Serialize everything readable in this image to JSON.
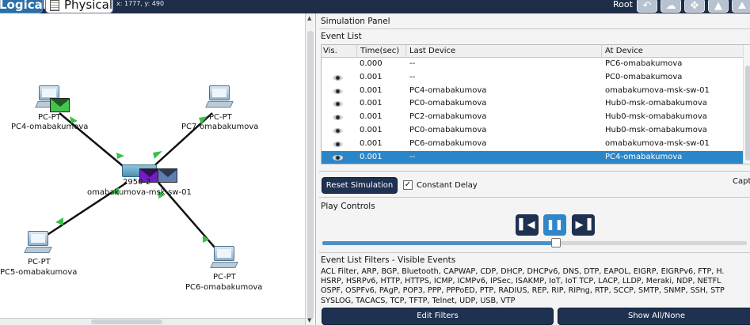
{
  "toolbar": {
    "tab_logical": "Logical",
    "tab_physical": "Physical",
    "coords": "x: 1777, y: 490",
    "root_label": "Root",
    "accent": "#2c6ea5",
    "bar_color": "#1e2d48"
  },
  "canvas": {
    "devices": [
      {
        "type": "PC-PT",
        "name": "PC4-omabakumova"
      },
      {
        "type": "PC-PT",
        "name": "PC7-omabakumova"
      },
      {
        "type": "2950-24",
        "name": "omabakumova-msk-sw-01",
        "type_visible": "2950-2"
      },
      {
        "type": "PC-PT",
        "name": "PC5-omabakumova"
      },
      {
        "type": "PC-PT",
        "name": "PC6-omabakumova"
      }
    ],
    "link_color": "#111111",
    "link_light_color": "#3bbf4a"
  },
  "panel": {
    "title": "Simulation Panel",
    "event_list": {
      "title": "Event List",
      "headers": {
        "vis": "Vis.",
        "time": "Time(sec)",
        "last": "Last Device",
        "at": "At Device"
      },
      "rows": [
        {
          "time": "0.000",
          "last": "--",
          "at": "PC6-omabakumova",
          "eye": false
        },
        {
          "time": "0.001",
          "last": "--",
          "at": "PC0-omabakumova",
          "eye": true
        },
        {
          "time": "0.001",
          "last": "PC4-omabakumova",
          "at": "omabakumova-msk-sw-01",
          "eye": true
        },
        {
          "time": "0.001",
          "last": "PC0-omabakumova",
          "at": "Hub0-msk-omabakumova",
          "eye": true
        },
        {
          "time": "0.001",
          "last": "PC2-omabakumova",
          "at": "Hub0-msk-omabakumova",
          "eye": true
        },
        {
          "time": "0.001",
          "last": "PC0-omabakumova",
          "at": "Hub0-msk-omabakumova",
          "eye": true
        },
        {
          "time": "0.001",
          "last": "PC6-omabakumova",
          "at": "omabakumova-msk-sw-01",
          "eye": true
        },
        {
          "time": "0.001",
          "last": "--",
          "at": "PC4-omabakumova",
          "eye": true,
          "selected": true
        }
      ]
    },
    "reset_button": "Reset Simulation",
    "constant_delay_label": "Constant Delay",
    "constant_delay_checked": true,
    "capture_label": "Capt",
    "play_controls": {
      "title": "Play Controls",
      "back_icon": "skip-back-icon",
      "pause_icon": "pause-icon",
      "forward_icon": "skip-forward-icon",
      "speed_fraction": 0.55
    },
    "filters": {
      "title": "Event List Filters - Visible Events",
      "lines": [
        "ACL Filter, ARP, BGP, Bluetooth, CAPWAP, CDP, DHCP, DHCPv6, DNS, DTP, EAPOL, EIGRP, EIGRPv6, FTP, H.",
        "HSRP, HSRPv6, HTTP, HTTPS, ICMP, ICMPv6, IPSec, ISAKMP, IoT, IoT TCP, LACP, LLDP, Meraki, NDP, NETFL",
        "OSPF, OSPFv6, PAgP, POP3, PPP, PPPoED, PTP, RADIUS, REP, RIP, RIPng, RTP, SCCP, SMTP, SNMP, SSH, STP",
        "SYSLOG, TACACS, TCP, TFTP, Telnet, UDP, USB, VTP"
      ],
      "edit_button": "Edit Filters",
      "show_all_button": "Show All/None"
    }
  }
}
